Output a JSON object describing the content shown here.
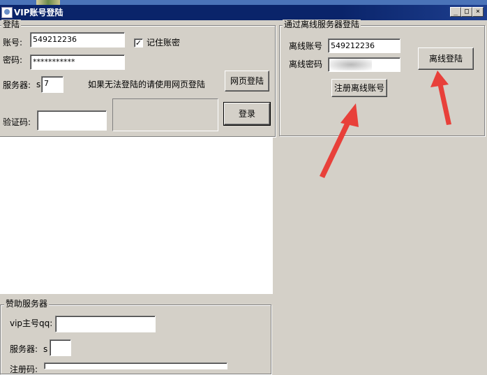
{
  "window": {
    "title": "VIP账号登陆",
    "min": "_",
    "max": "□",
    "close": "×"
  },
  "login": {
    "group": "登陆",
    "account_label": "账号:",
    "account_value": "549212236",
    "password_label": "密码:",
    "password_value": "***********",
    "remember": "记住账密",
    "remember_checked": "✓",
    "server_label": "服务器:",
    "server_prefix": "s",
    "server_value": "7",
    "hint": "如果无法登陆的请使用网页登陆",
    "web_login": "网页登陆",
    "captcha_label": "验证码:",
    "login_button": "登录"
  },
  "offline": {
    "group": "通过离线服务器登陆",
    "account_label": "离线账号",
    "account_value": "549212236",
    "password_label": "离线密码",
    "password_value": "",
    "register_button": "注册离线账号",
    "login_button": "离线登陆"
  },
  "sponsor": {
    "group": "赞助服务器",
    "vip_qq_label": "vip主号qq:",
    "vip_qq_value": "",
    "server_label": "服务器:",
    "server_prefix": "s",
    "server_value": "",
    "bottom_label": "注册码:"
  },
  "colors": {
    "titlebar": "#0a246a",
    "face": "#d4d0c8",
    "arrow": "#e8403a"
  }
}
